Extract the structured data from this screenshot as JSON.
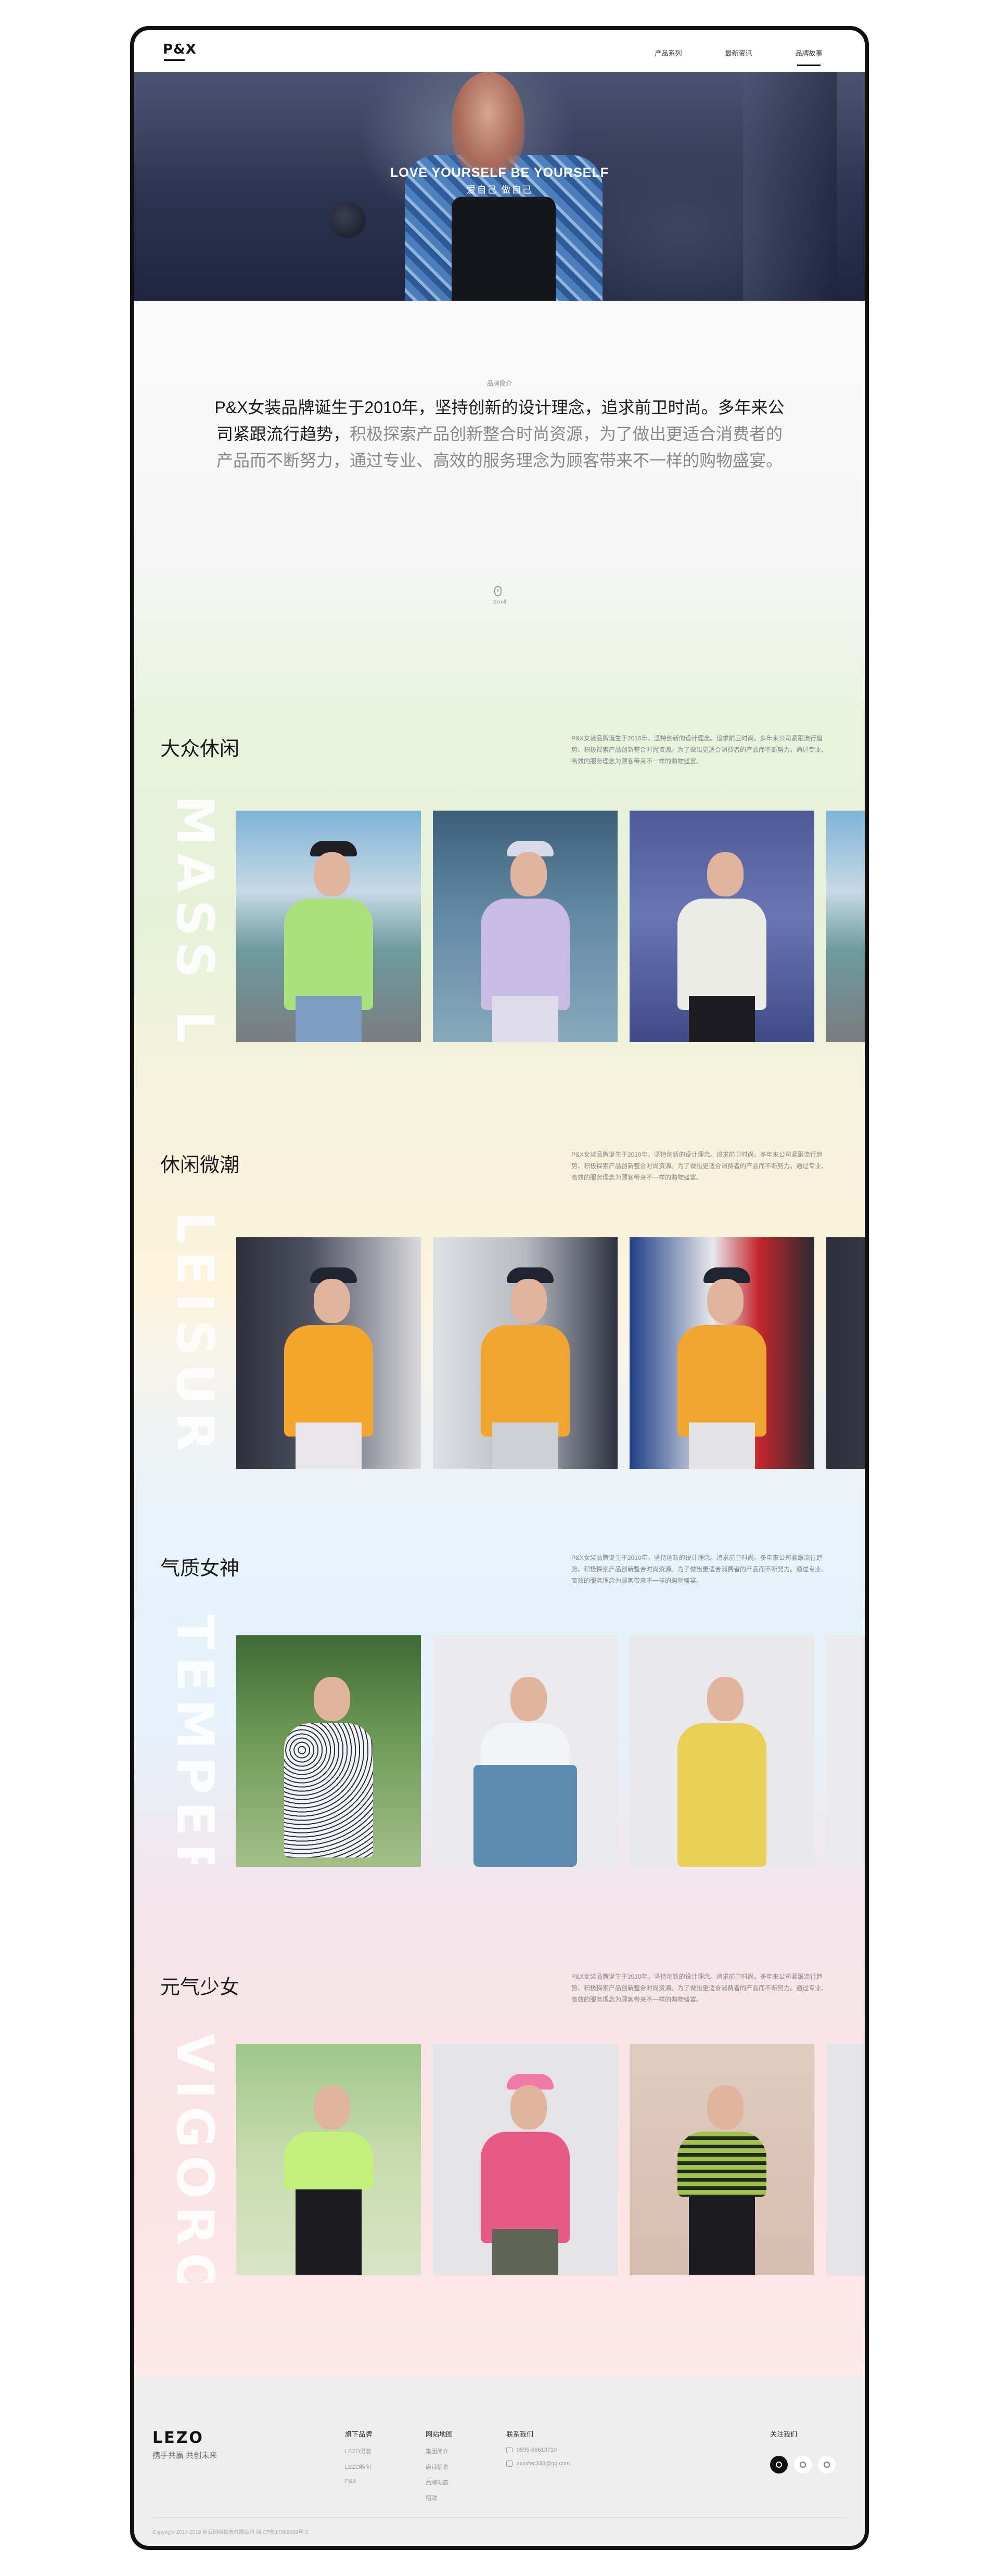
{
  "nav": {
    "logo": "P&X",
    "links": [
      "产品系列",
      "最新资讯",
      "品牌故事"
    ],
    "active_index": 2
  },
  "hero": {
    "title": "LOVE YOURSELF  BE YOURSELF",
    "subtitle": "爱自己 做自己"
  },
  "intro": {
    "label": "品牌简介",
    "text_dark": "P&X女装品牌诞生于2010年，坚持创新的设计理念，追求前卫时尚。多年来公司紧跟流行趋势，",
    "text_grey": "积极探索产品创新整合时尚资源，为了做出更适合消费者的产品而不断努力，通过专业、高效的服务理念为顾客带来不一样的购物盛宴。",
    "scroll_label": "Scroll"
  },
  "categories": [
    {
      "title": "大众休闲",
      "en": "MASS LEISURE",
      "desc": "P&X女装品牌诞生于2010年，坚持创新的设计理念。追求前卫时尚。多年来公司紧跟流行趋势、积极探索产品创新整合时尚资源。为了做出更适合消费者的产品而不断努力。通过专业、高效的服务理念为顾客带来不一样的购物盛宴。"
    },
    {
      "title": "休闲微潮",
      "en": "LEISURE TREND",
      "desc": "P&X女装品牌诞生于2010年，坚持创新的设计理念。追求前卫时尚。多年来公司紧跟流行趋势、积极探索产品创新整合时尚资源。为了做出更适合消费者的产品而不断努力。通过专业、高效的服务理念为顾客带来不一样的购物盛宴。"
    },
    {
      "title": "气质女神",
      "en": "TEMPERAMENT",
      "desc": "P&X女装品牌诞生于2010年，坚持创新的设计理念。追求前卫时尚。多年来公司紧跟流行趋势、积极探索产品创新整合时尚资源。为了做出更适合消费者的产品而不断努力。通过专业、高效的服务理念为顾客带来不一样的购物盛宴。"
    },
    {
      "title": "元气少女",
      "en": "VIGOROUS",
      "desc": "P&X女装品牌诞生于2010年，坚持创新的设计理念。追求前卫时尚。多年来公司紧跟流行趋势、积极探索产品创新整合时尚资源。为了做出更适合消费者的产品而不断努力。通过专业、高效的服务理念为顾客带来不一样的购物盛宴。"
    }
  ],
  "footer": {
    "logo": "LEZO",
    "slogan": "携手共赢 共创未来",
    "brands": {
      "heading": "旗下品牌",
      "items": [
        "LEZO男装",
        "LEZO鞋包",
        "P&X"
      ]
    },
    "sitemap": {
      "heading": "网站地图",
      "items": [
        "集团简介",
        "店铺信息",
        "品牌动态",
        "招聘"
      ]
    },
    "contact": {
      "heading": "联系我们",
      "phone": "0595-86613710",
      "email": "xxxxfec333@qq.com"
    },
    "follow": {
      "heading": "关注我们",
      "icons": [
        "wechat-icon",
        "tiktok-icon",
        "weibo-icon"
      ]
    },
    "copyright": "Copyright 2014-2019 新浪网络信息有限公司 闽ICP备17069089号-3"
  },
  "colors": {
    "accent": "#111111",
    "hero_bg": "#2c3350",
    "green_band": "#e7f3dc",
    "yellow_band": "#fcf3dc",
    "blue_band": "#e7f2fb",
    "pink_band": "#fbe3e3"
  }
}
